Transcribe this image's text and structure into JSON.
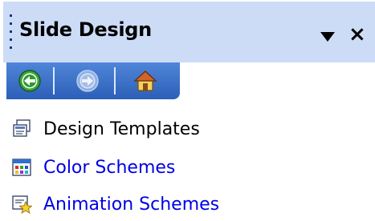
{
  "pane": {
    "title": "Slide Design",
    "close_glyph": "×",
    "dropdown_icon": "triangle-down-icon"
  },
  "navbar": {
    "buttons": [
      {
        "icon": "back-arrow-icon",
        "enabled": true
      },
      {
        "icon": "forward-arrow-icon",
        "enabled": false
      },
      {
        "icon": "home-icon",
        "enabled": true
      }
    ]
  },
  "items": [
    {
      "label": "Design Templates",
      "icon": "design-templates-icon",
      "style": "plain"
    },
    {
      "label": "Color Schemes",
      "icon": "color-schemes-icon",
      "style": "link"
    },
    {
      "label": "Animation Schemes",
      "icon": "animation-schemes-icon",
      "style": "link"
    }
  ],
  "colors": {
    "titlebar_bg": "#cddcf6",
    "navbar": "#2c5fb8",
    "link": "#0000e6"
  }
}
